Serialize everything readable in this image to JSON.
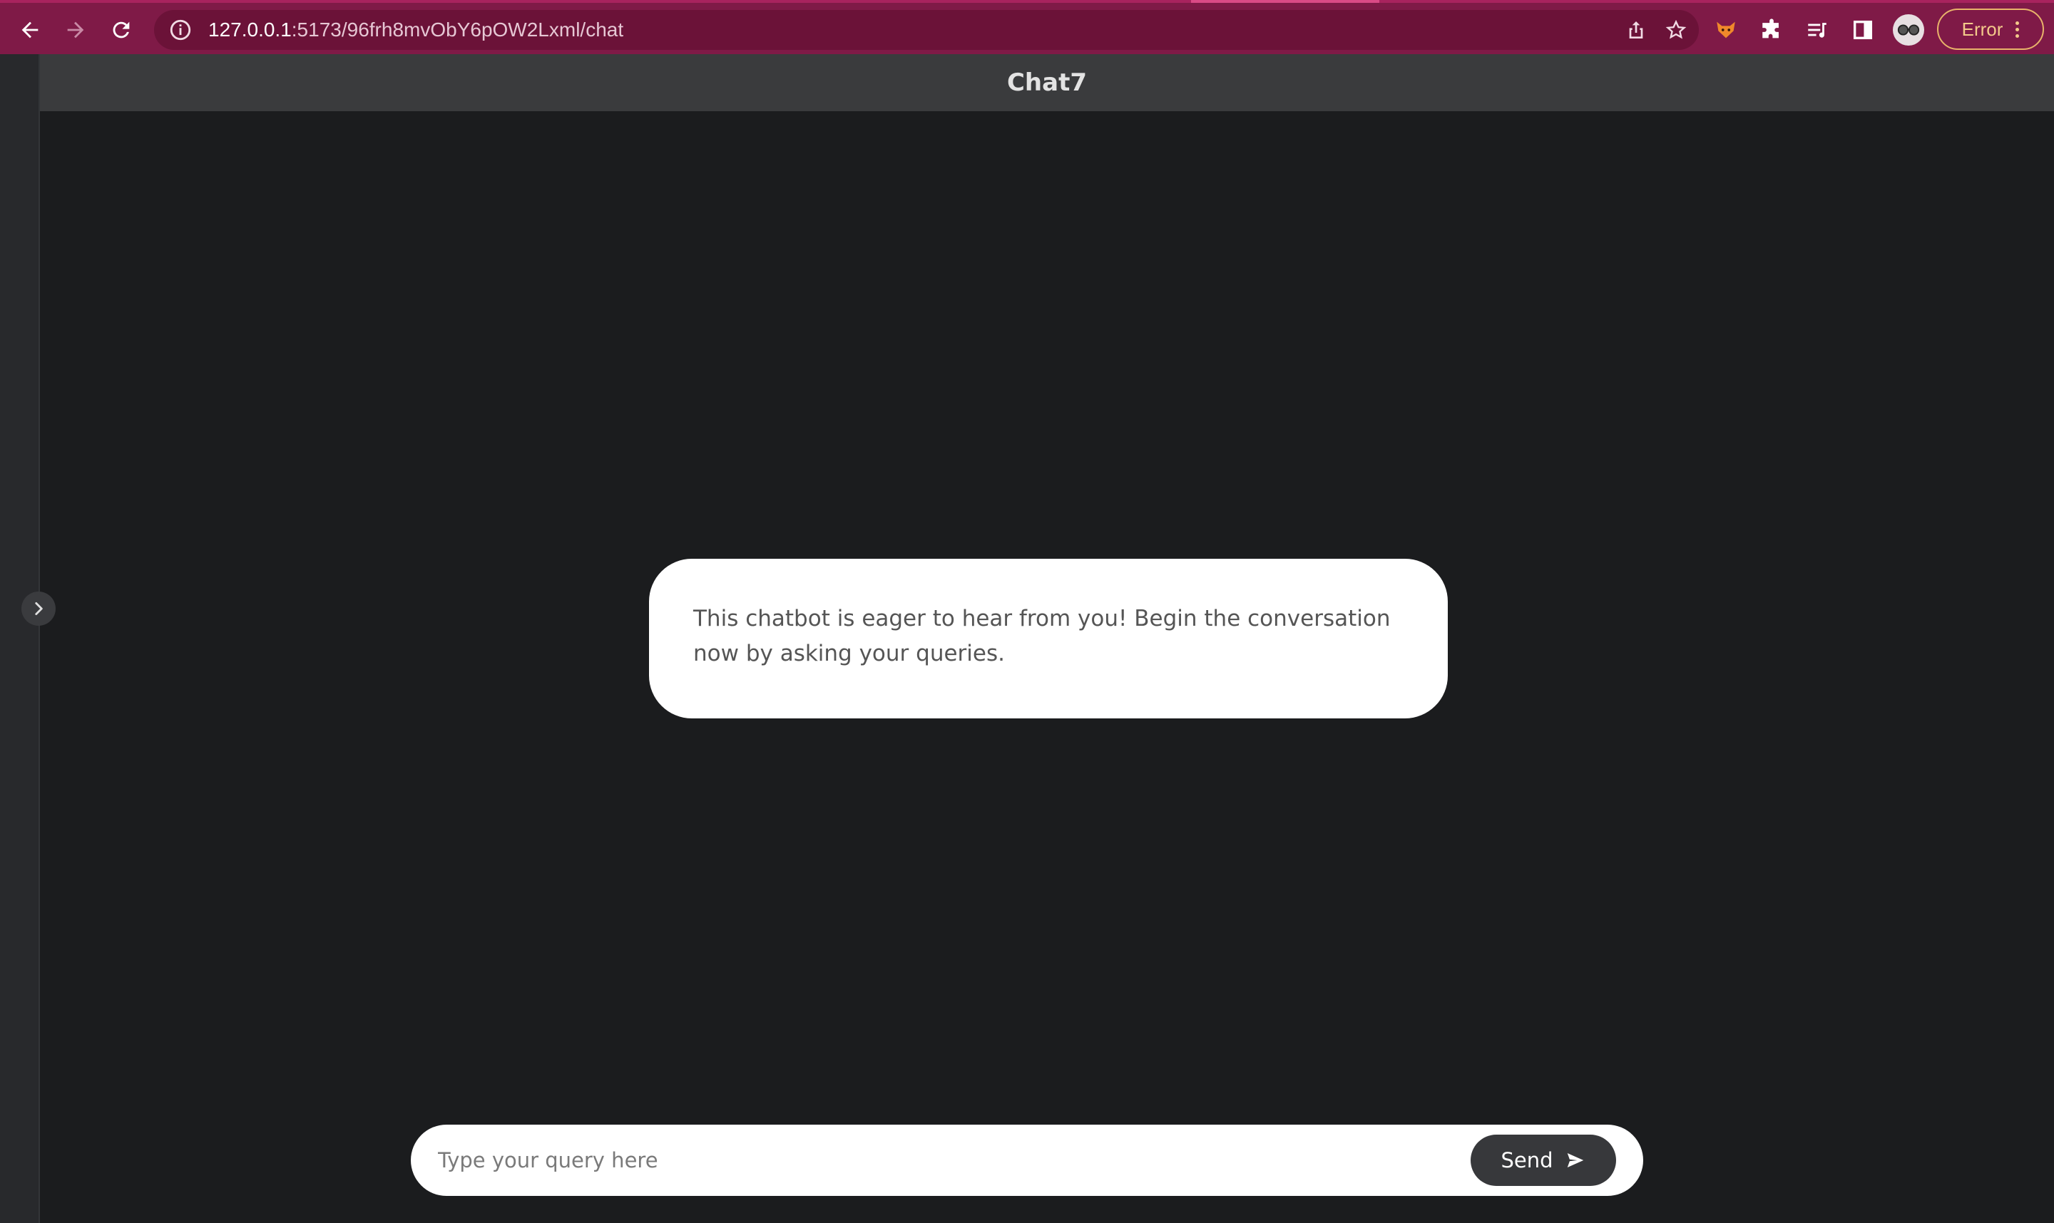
{
  "browser": {
    "url_host": "127.0.0.1",
    "url_path": ":5173/96frh8mvObY6pOW2Lxml/chat",
    "error_label": "Error",
    "accent_color": "#7f1a47"
  },
  "app": {
    "title": "Chat7"
  },
  "chat": {
    "welcome_message": "This chatbot is eager to hear from you! Begin the conversation now by asking your queries."
  },
  "composer": {
    "placeholder": "Type your query here",
    "send_label": "Send"
  },
  "icons": [
    "back-icon",
    "forward-icon",
    "reload-icon",
    "info-icon",
    "share-icon",
    "star-icon",
    "fox-extension-icon",
    "puzzle-icon",
    "reading-list-icon",
    "side-panel-icon",
    "avatar",
    "chevron-right-icon",
    "send-icon"
  ]
}
